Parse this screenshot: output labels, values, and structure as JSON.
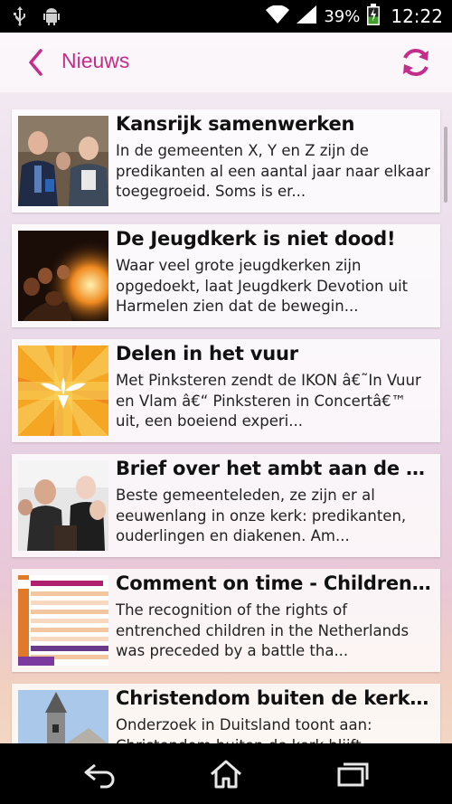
{
  "status_bar": {
    "battery_percent": "39%",
    "time": "12:22",
    "icons": [
      "usb-icon",
      "android-icon",
      "wifi-icon",
      "signal-icon",
      "battery-charging-icon"
    ]
  },
  "header": {
    "title": "Nieuws",
    "back_icon": "chevron-left-icon",
    "refresh_icon": "refresh-icon",
    "accent_color": "#c42d8a"
  },
  "articles": [
    {
      "title": "Kansrijk samenwerken",
      "excerpt": "In de gemeenten X, Y en Z zijn de predikanten al een aantal jaar naar elkaar toegegroeid. Soms is er...",
      "thumbnail": "photo-men-talking"
    },
    {
      "title": "De Jeugdkerk is niet dood!",
      "excerpt": "Waar veel grote jeugdkerken zijn opgedoekt, laat Jeugdkerk Devotion uit Harmelen zien dat de bewegin...",
      "thumbnail": "photo-campfire-group"
    },
    {
      "title": "Delen in het vuur",
      "excerpt": "Met Pinksteren zendt de IKON â€˜In Vuur en Vlam â€“ Pinksteren in Concertâ€™ uit, een boeiend experi...",
      "thumbnail": "dove-on-flames-graphic"
    },
    {
      "title": "Brief over het ambt aan de ge...",
      "excerpt": "Beste gemeenteleden, ze zijn er al eeuwenlang in onze kerk: predikanten, ouderlingen en diakenen. Am...",
      "thumbnail": "photo-audience"
    },
    {
      "title": "Comment on time - Children'...",
      "excerpt": "The recognition of the rights of entrenched children in the Netherlands was preceded by a battle tha...",
      "thumbnail": "document-scan"
    },
    {
      "title": "Christendom buiten de kerk h...",
      "excerpt": "Onderzoek in Duitsland toont aan: Christendom buiten de kerk blijft...",
      "thumbnail": "photo-church-tower"
    }
  ],
  "nav_bar": {
    "icons": [
      "back-icon",
      "home-icon",
      "recent-apps-icon"
    ]
  }
}
